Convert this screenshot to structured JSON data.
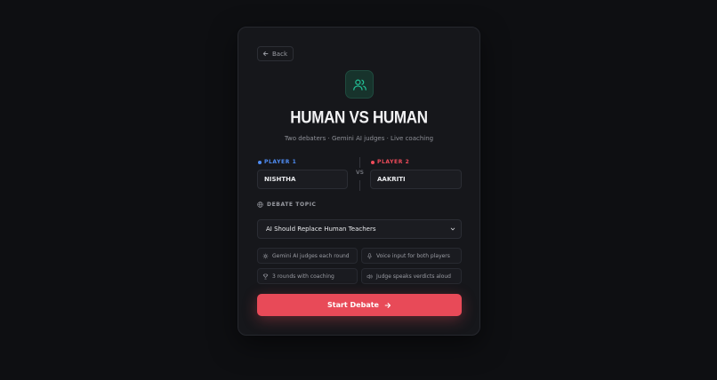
{
  "back": {
    "label": "Back"
  },
  "header": {
    "title": "HUMAN VS HUMAN",
    "subtitle": "Two debaters · Gemini AI judges · Live coaching"
  },
  "players": {
    "p1": {
      "label": "PLAYER 1",
      "value": "NISHTHA"
    },
    "p2": {
      "label": "PLAYER 2",
      "value": "AAKRITI"
    },
    "vs": "VS"
  },
  "topic": {
    "label": "DEBATE TOPIC",
    "selected": "AI Should Replace Human Teachers"
  },
  "features": [
    {
      "label": "Gemini AI judges each round",
      "icon": "brain-icon"
    },
    {
      "label": "Voice input for both players",
      "icon": "mic-icon"
    },
    {
      "label": "3 rounds with coaching",
      "icon": "trophy-icon"
    },
    {
      "label": "Judge speaks verdicts aloud",
      "icon": "speaker-icon"
    }
  ],
  "start": {
    "label": "Start Debate"
  },
  "colors": {
    "accent_green": "#22c197",
    "player1": "#4f8df5",
    "player2": "#ef4b5a",
    "start_button": "#e84a58"
  }
}
